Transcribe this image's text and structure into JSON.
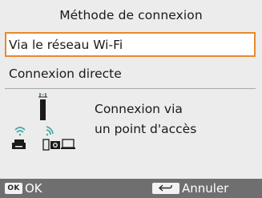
{
  "screen": {
    "title": "Méthode de connexion"
  },
  "menu": {
    "items": [
      {
        "label": "Via le réseau Wi-Fi",
        "selected": true
      },
      {
        "label": "Connexion directe",
        "selected": false
      }
    ]
  },
  "description": {
    "line1": "Connexion via",
    "line2": "un point d'accès"
  },
  "illustration": {
    "icons": [
      "access-point-icon",
      "wifi-signal-icon",
      "printer-icon",
      "camera-icon",
      "laptop-icon"
    ]
  },
  "footer": {
    "ok_key": "OK",
    "ok_label": "OK",
    "back_key_icon": "return-arrow-icon",
    "cancel_label": "Annuler"
  },
  "colors": {
    "accent": "#e8892e",
    "wifi": "#3aa6a1",
    "footer_bg": "#6f6f6f",
    "background": "#ececec"
  }
}
